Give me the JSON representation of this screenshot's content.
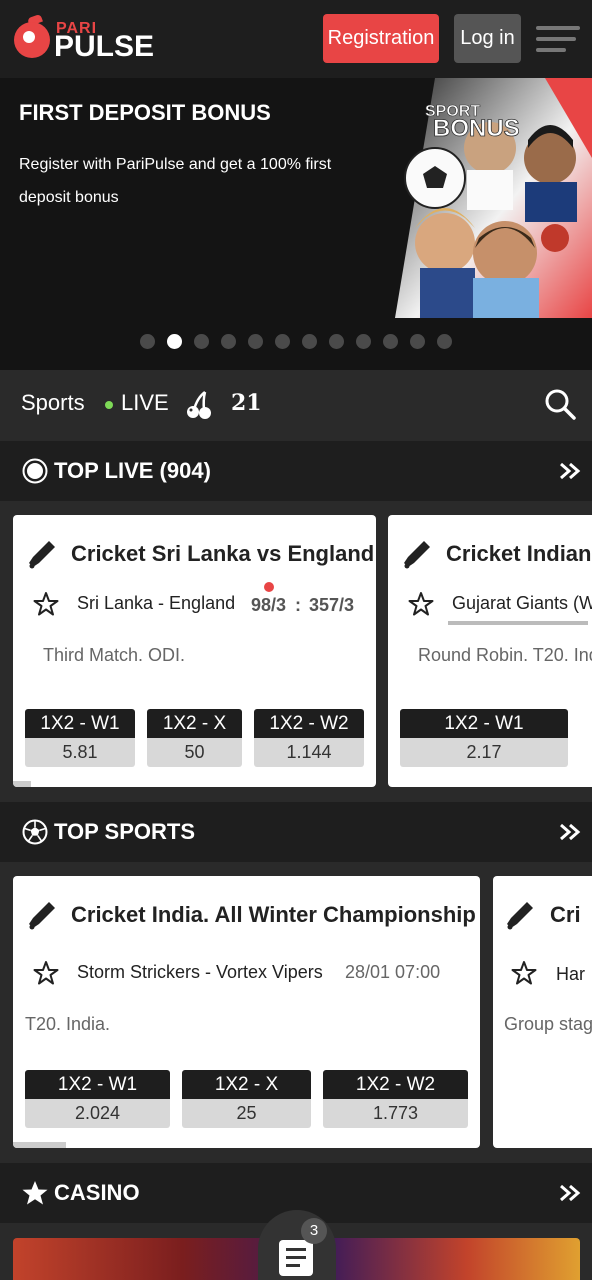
{
  "header": {
    "logo_top": "PARI",
    "logo_bottom": "PULSE",
    "register_label": "Registration",
    "login_label": "Log in",
    "menu_icon": "hamburger-icon"
  },
  "banner": {
    "title": "FIRST DEPOSIT BONUS",
    "text": "Register with PariPulse and get a 100% first deposit bonus",
    "art_text_1": "SPORT",
    "art_text_2": "BONUS",
    "slide_count": 12,
    "active_slide": 2
  },
  "nav": {
    "sports_label": "Sports",
    "live_label": "LIVE",
    "slots_icon": "cherry-icon",
    "game_label": "21",
    "search_icon": "search-icon"
  },
  "top_live": {
    "title": "TOP LIVE (904)",
    "cards": [
      {
        "title": "Cricket Sri Lanka vs England",
        "teams": "Sri Lanka - England",
        "score_home": "98/3",
        "score_sep": ":",
        "score_away": "357/3",
        "league": "Third Match. ODI.",
        "odds": [
          {
            "label": "1X2 - W1",
            "value": "5.81"
          },
          {
            "label": "1X2 - X",
            "value": "50"
          },
          {
            "label": "1X2 - W2",
            "value": "1.144"
          }
        ]
      },
      {
        "title": "Cricket Indian",
        "teams": "Gujarat Giants (W",
        "league": "Round Robin. T20. Ind",
        "odds": [
          {
            "label": "1X2 - W1",
            "value": "2.17"
          }
        ]
      }
    ]
  },
  "top_sports": {
    "title": "TOP SPORTS",
    "cards": [
      {
        "title": "Cricket India. All Winter Championship",
        "teams": "Storm Strickers - Vortex Vipers",
        "time": "28/01 07:00",
        "league": "T20. India.",
        "odds": [
          {
            "label": "1X2 - W1",
            "value": "2.024"
          },
          {
            "label": "1X2 - X",
            "value": "25"
          },
          {
            "label": "1X2 - W2",
            "value": "1.773"
          }
        ]
      },
      {
        "title": "Cri",
        "teams": "Har",
        "league": "Group stag"
      }
    ]
  },
  "casino": {
    "title": "CASINO",
    "betslip_count": "3"
  }
}
